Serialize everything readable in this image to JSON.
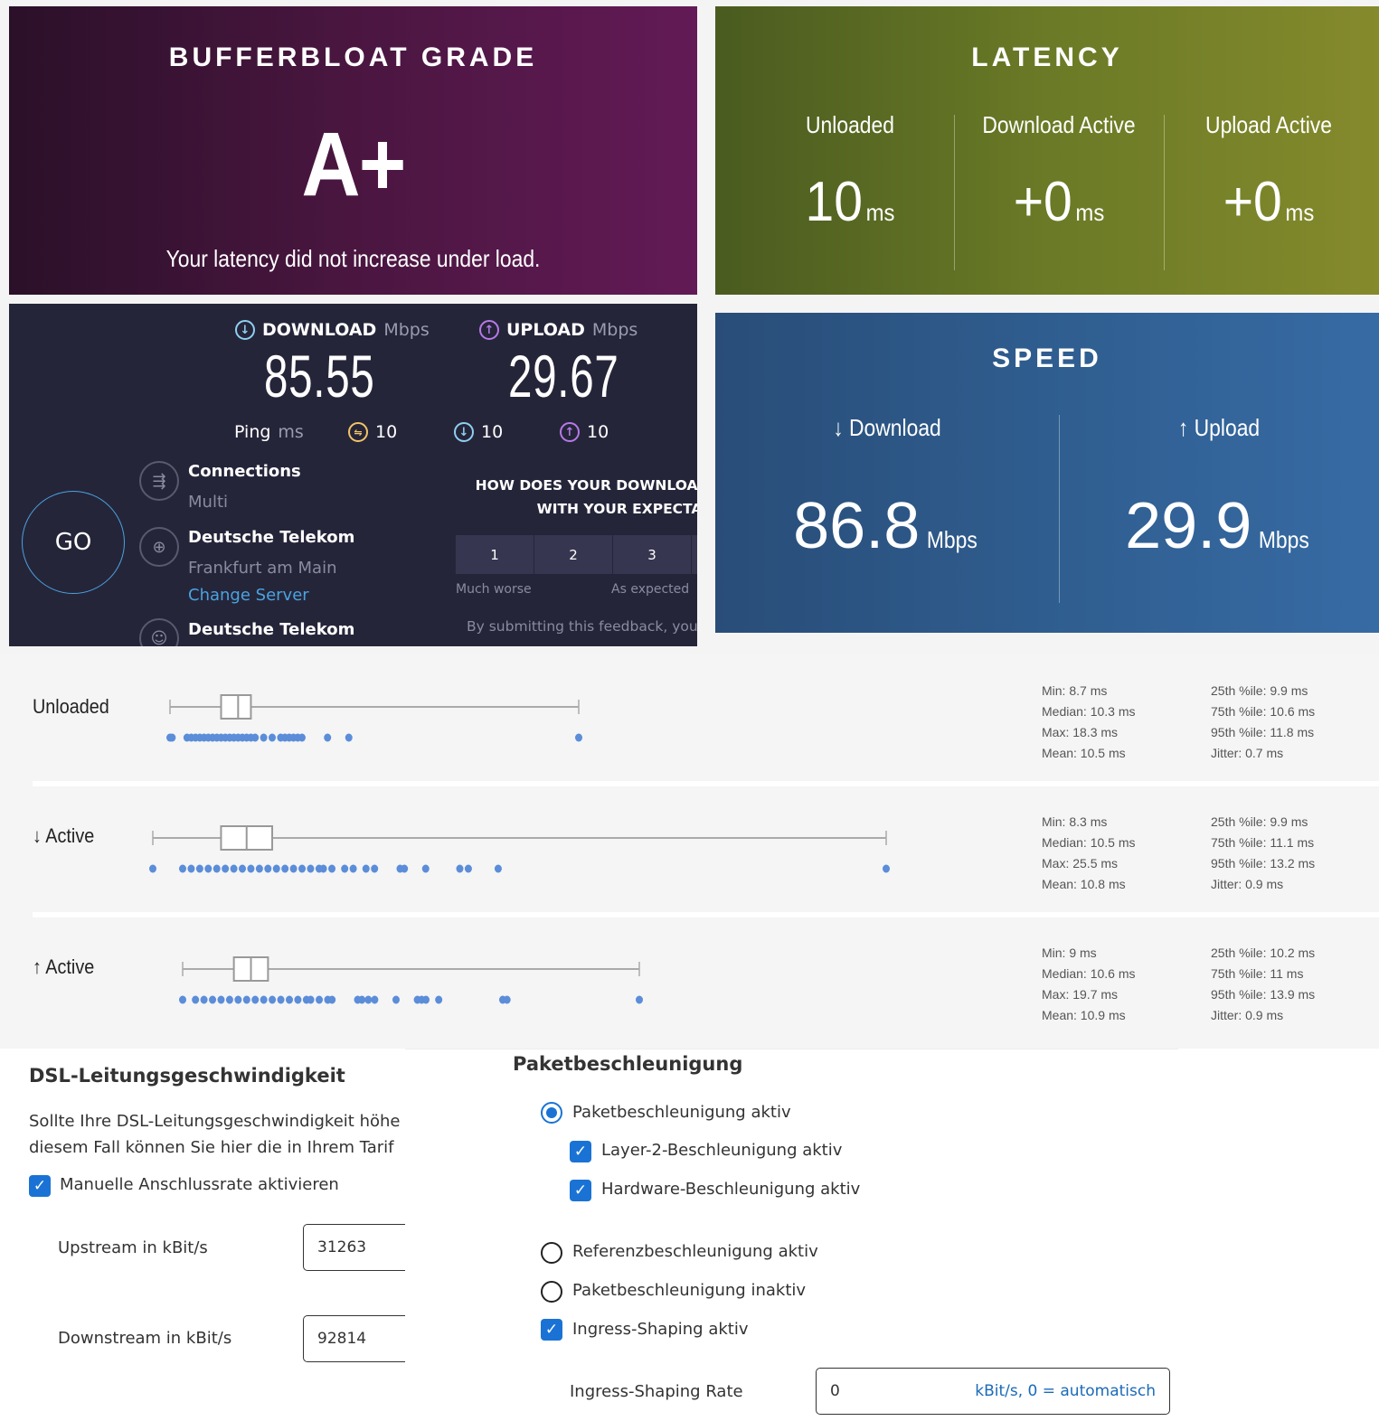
{
  "bufferbloat": {
    "title": "BUFFERBLOAT GRADE",
    "grade": "A+",
    "message": "Your latency did not increase under load.",
    "colors": {
      "from": "#2b1029",
      "to": "#631a56"
    }
  },
  "latency": {
    "title": "LATENCY",
    "columns": [
      {
        "label": "Unloaded",
        "value": "10",
        "unit": "ms"
      },
      {
        "label": "Download Active",
        "value": "+0",
        "unit": "ms"
      },
      {
        "label": "Upload Active",
        "value": "+0",
        "unit": "ms"
      }
    ]
  },
  "speedtest": {
    "download": {
      "label": "DOWNLOAD",
      "unit": "Mbps",
      "value": "85.55",
      "icon": "arrow-down-circle-icon",
      "color": "#8fd0f0"
    },
    "upload": {
      "label": "UPLOAD",
      "unit": "Mbps",
      "value": "29.67",
      "icon": "arrow-up-circle-icon",
      "color": "#b77ae6"
    },
    "ping": {
      "label": "Ping",
      "unit": "ms",
      "idle": "10",
      "download": "10",
      "upload": "10",
      "idle_color": "#f3c466"
    },
    "go_label": "GO",
    "connections": {
      "title": "Connections",
      "value": "Multi"
    },
    "server": {
      "isp": "Deutsche Telekom",
      "location": "Frankfurt am Main",
      "change_label": "Change Server"
    },
    "provider": {
      "name": "Deutsche Telekom"
    },
    "feedback": {
      "question_line1": "HOW DOES YOUR DOWNLOAD",
      "question_line2": "WITH YOUR EXPECTA",
      "scale": [
        "1",
        "2",
        "3",
        ""
      ],
      "low_label": "Much worse",
      "mid_label": "As expected",
      "note": "By submitting this feedback, you"
    }
  },
  "speed": {
    "title": "SPEED",
    "download": {
      "label": "↓ Download",
      "value": "86.8",
      "unit": "Mbps"
    },
    "upload": {
      "label": "↑ Upload",
      "value": "29.9",
      "unit": "Mbps"
    }
  },
  "chart_data": {
    "type": "boxplot",
    "unit": "ms",
    "axis_note": "each row scaled independently from min to max",
    "rows": [
      {
        "label": "Unloaded",
        "min": 8.7,
        "q1": 9.9,
        "median": 10.3,
        "q3": 10.6,
        "max": 18.3,
        "mean": 10.5,
        "p95": 11.8,
        "jitter": 0.7,
        "stats_left": [
          "Min: 8.7 ms",
          "Median: 10.3 ms",
          "Max: 18.3 ms",
          "Mean: 10.5 ms"
        ],
        "stats_right": [
          "25th %ile: 9.9 ms",
          "75th %ile: 10.6 ms",
          "95th %ile: 11.8 ms",
          "Jitter: 0.7 ms"
        ],
        "points": [
          8.7,
          8.75,
          9.1,
          9.2,
          9.3,
          9.4,
          9.5,
          9.6,
          9.7,
          9.8,
          9.9,
          10.0,
          10.1,
          10.2,
          10.3,
          10.4,
          10.5,
          10.6,
          10.7,
          10.9,
          11.1,
          11.3,
          11.4,
          11.5,
          11.6,
          11.7,
          11.8,
          12.4,
          12.9,
          18.3
        ]
      },
      {
        "label": "↓ Active",
        "min": 8.3,
        "q1": 9.9,
        "median": 10.5,
        "q3": 11.1,
        "max": 25.5,
        "mean": 10.8,
        "p95": 13.2,
        "jitter": 0.9,
        "stats_left": [
          "Min: 8.3 ms",
          "Median: 10.5 ms",
          "Max: 25.5 ms",
          "Mean: 10.8 ms"
        ],
        "stats_right": [
          "25th %ile: 9.9 ms",
          "75th %ile: 11.1 ms",
          "95th %ile: 13.2 ms",
          "Jitter: 0.9 ms"
        ],
        "points": [
          8.3,
          9.0,
          9.2,
          9.4,
          9.6,
          9.8,
          10.0,
          10.2,
          10.4,
          10.6,
          10.8,
          11.0,
          11.2,
          11.4,
          11.6,
          11.8,
          12.0,
          12.2,
          12.3,
          12.5,
          12.8,
          13.0,
          13.3,
          13.5,
          14.1,
          14.2,
          14.7,
          15.5,
          15.7,
          16.4,
          25.5
        ]
      },
      {
        "label": "↑ Active",
        "min": 9,
        "q1": 10.2,
        "median": 10.6,
        "q3": 11,
        "max": 19.7,
        "mean": 10.9,
        "p95": 13.9,
        "jitter": 0.9,
        "stats_left": [
          "Min: 9 ms",
          "Median: 10.6 ms",
          "Max: 19.7 ms",
          "Mean: 10.9 ms"
        ],
        "stats_right": [
          "25th %ile: 10.2 ms",
          "75th %ile: 11 ms",
          "95th %ile: 13.9 ms",
          "Jitter: 0.9 ms"
        ],
        "points": [
          9.0,
          9.3,
          9.5,
          9.7,
          9.9,
          10.1,
          10.3,
          10.5,
          10.7,
          10.9,
          11.1,
          11.3,
          11.5,
          11.7,
          11.9,
          12.0,
          12.2,
          12.4,
          12.5,
          13.1,
          13.2,
          13.35,
          13.5,
          14.0,
          14.5,
          14.6,
          14.7,
          15.0,
          16.5,
          16.6,
          19.7
        ]
      }
    ]
  },
  "dsl": {
    "title": "DSL-Leitungsgeschwindigkeit",
    "text_line1": "Sollte Ihre DSL-Leitungsgeschwindigkeit höhe",
    "text_line2": "diesem Fall können Sie hier die in Ihrem Tarif",
    "manual_rate_label": "Manuelle Anschlussrate aktivieren",
    "manual_rate_checked": true,
    "upstream_label": "Upstream in kBit/s",
    "upstream_value": "31263",
    "downstream_label": "Downstream in kBit/s",
    "downstream_value": "92814"
  },
  "packet": {
    "title": "Paketbeschleunigung",
    "options": [
      {
        "label": "Paketbeschleunigung aktiv",
        "type": "radio",
        "checked": true
      },
      {
        "label": "Layer-2-Beschleunigung aktiv",
        "type": "checkbox",
        "checked": true
      },
      {
        "label": "Hardware-Beschleunigung aktiv",
        "type": "checkbox",
        "checked": true
      },
      {
        "label": "Referenzbeschleunigung aktiv",
        "type": "radio",
        "checked": false
      },
      {
        "label": "Paketbeschleunigung inaktiv",
        "type": "radio",
        "checked": false
      },
      {
        "label": "Ingress-Shaping aktiv",
        "type": "checkbox",
        "checked": true
      }
    ],
    "ingress_rate_label": "Ingress-Shaping Rate",
    "ingress_rate_value": "0",
    "ingress_rate_suffix": "kBit/s, 0 = automatisch"
  }
}
